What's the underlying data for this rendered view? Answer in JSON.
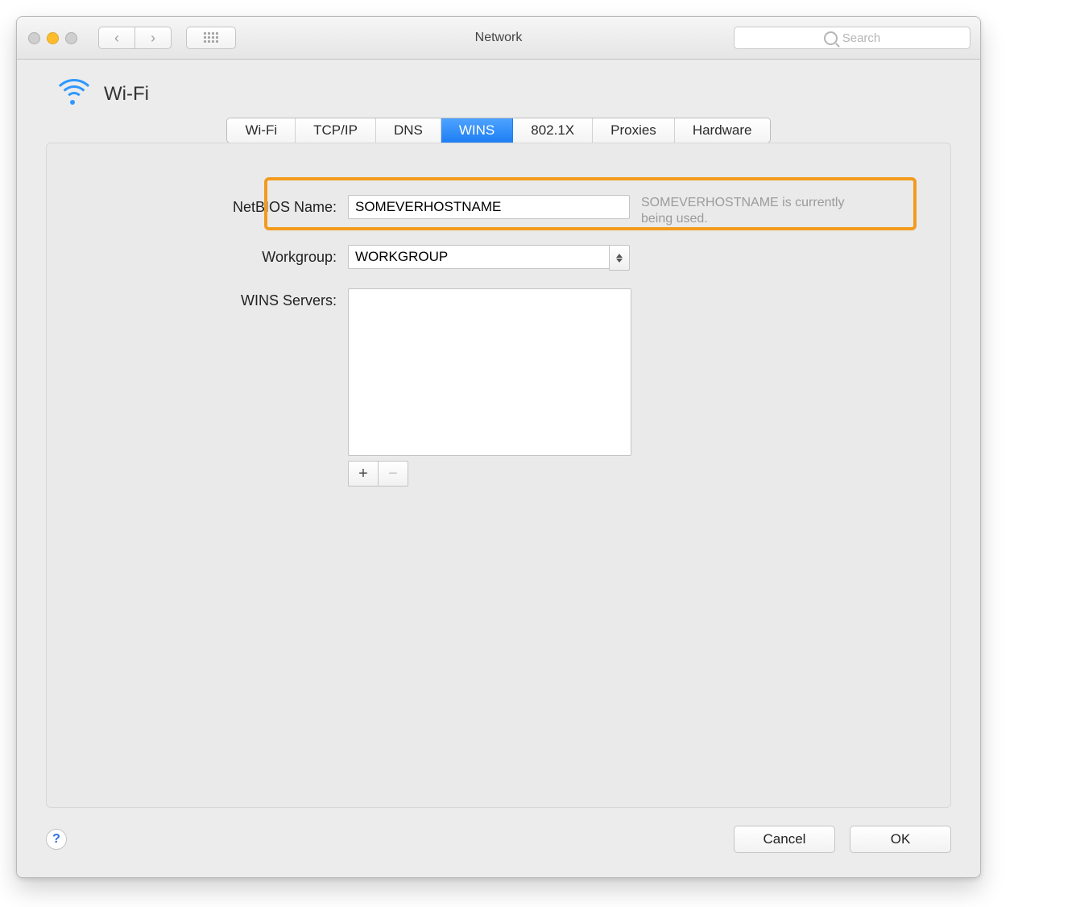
{
  "window": {
    "title": "Network"
  },
  "search": {
    "placeholder": "Search"
  },
  "heading": {
    "title": "Wi-Fi"
  },
  "tabs": [
    {
      "label": "Wi-Fi",
      "active": false
    },
    {
      "label": "TCP/IP",
      "active": false
    },
    {
      "label": "DNS",
      "active": false
    },
    {
      "label": "WINS",
      "active": true
    },
    {
      "label": "802.1X",
      "active": false
    },
    {
      "label": "Proxies",
      "active": false
    },
    {
      "label": "Hardware",
      "active": false
    }
  ],
  "form": {
    "netbios_label": "NetBIOS Name:",
    "netbios_value": "SOMEVERHOSTNAME",
    "netbios_hint": "SOMEVERHOSTNAME is currently being used.",
    "workgroup_label": "Workgroup:",
    "workgroup_value": "WORKGROUP",
    "wins_label": "WINS Servers:",
    "add_label": "+",
    "remove_label": "−"
  },
  "footer": {
    "help_label": "?",
    "cancel_label": "Cancel",
    "ok_label": "OK"
  },
  "highlight_color": "#f39b1f"
}
